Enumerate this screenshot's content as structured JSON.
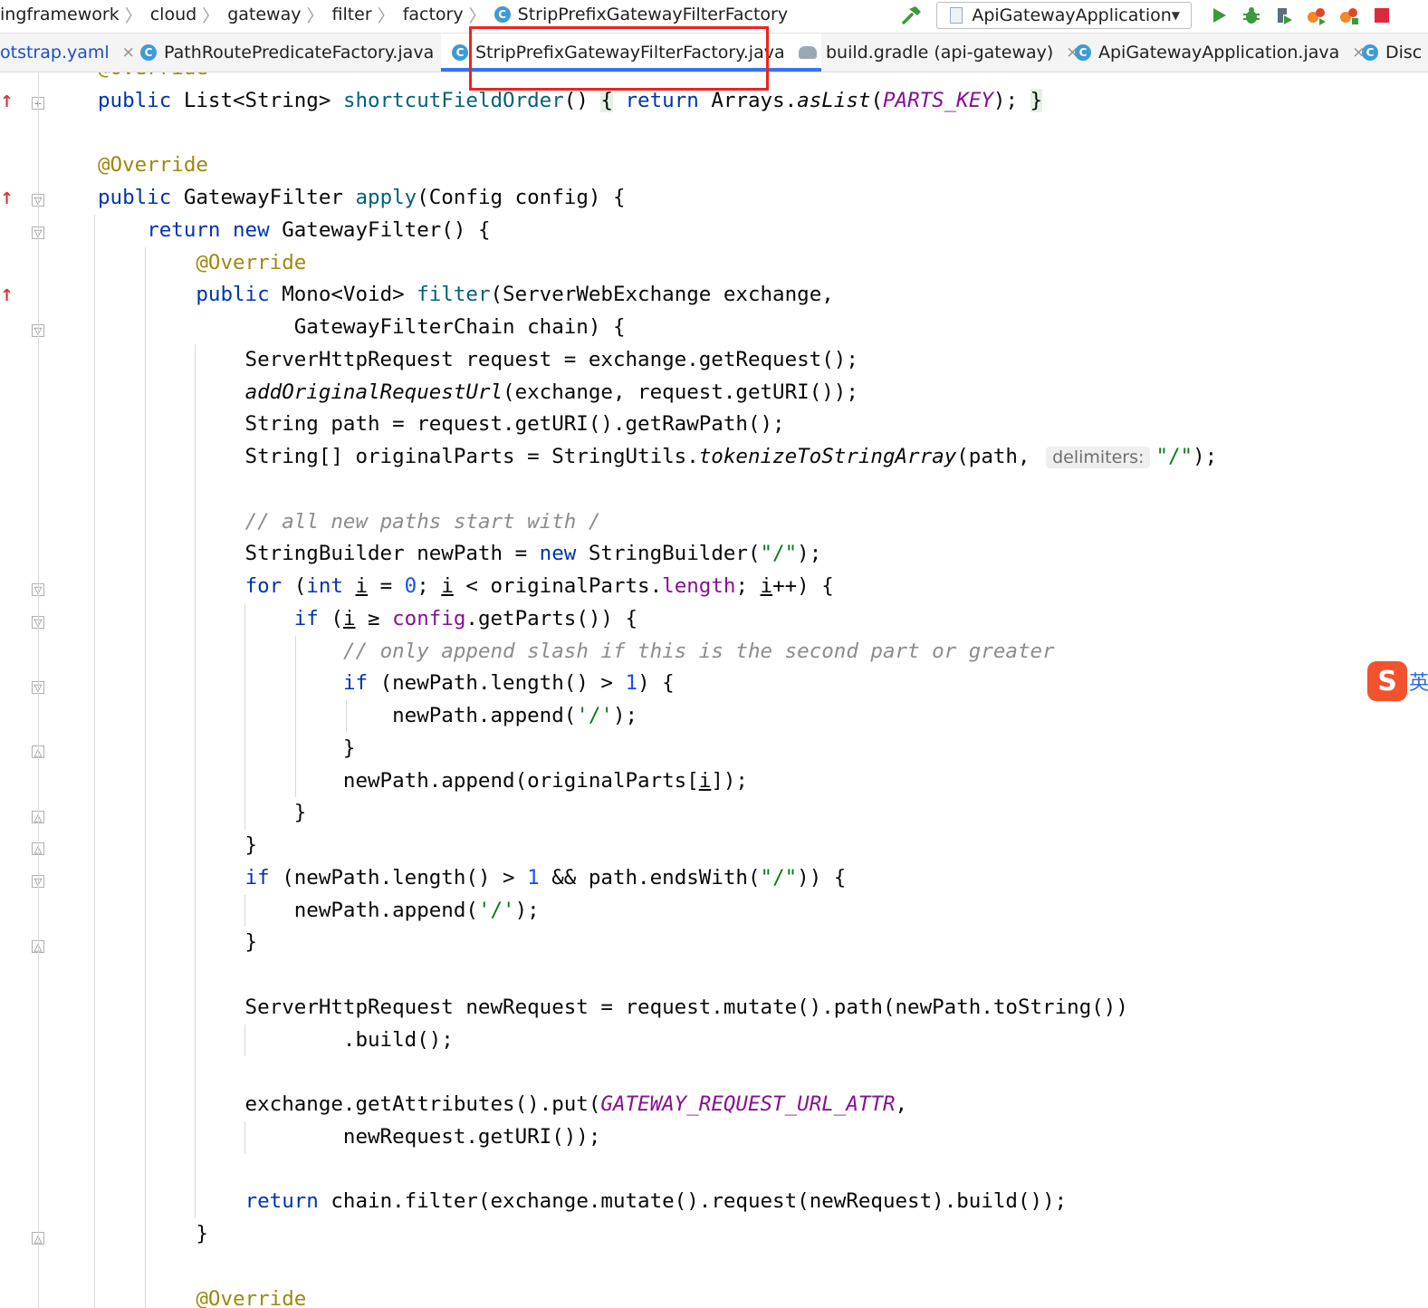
{
  "breadcrumbs": [
    "ingframework",
    "cloud",
    "gateway",
    "filter",
    "factory",
    "StripPrefixGatewayFilterFactory"
  ],
  "run_config": {
    "label": "ApiGatewayApplication"
  },
  "tabs": [
    {
      "label": "otstrap.yaml"
    },
    {
      "label": "PathRoutePredicateFactory.java"
    },
    {
      "label": "StripPrefixGatewayFilterFactory.java"
    },
    {
      "label": "build.gradle (api-gateway)"
    },
    {
      "label": "ApiGatewayApplication.java"
    },
    {
      "label": "Disc"
    }
  ],
  "close_glyph": "×",
  "editor": {
    "param_hint": "delimiters:"
  },
  "icons": [
    "class-icon",
    "hammer-icon",
    "run-icon",
    "debug-icon",
    "coverage-icon",
    "profile-icon",
    "stop-icon",
    "gradle-icon",
    "override-marker-icon",
    "fold-icon",
    "sogou-ime-icon"
  ],
  "colors": {
    "keyword": "#0033b3",
    "annotation": "#9e880d",
    "method": "#00627a",
    "string": "#067d17",
    "number": "#1750eb",
    "comment": "#8c8c8c",
    "constant": "#871094",
    "tab_underline": "#3574f0",
    "highlight_box": "#ee2222"
  }
}
